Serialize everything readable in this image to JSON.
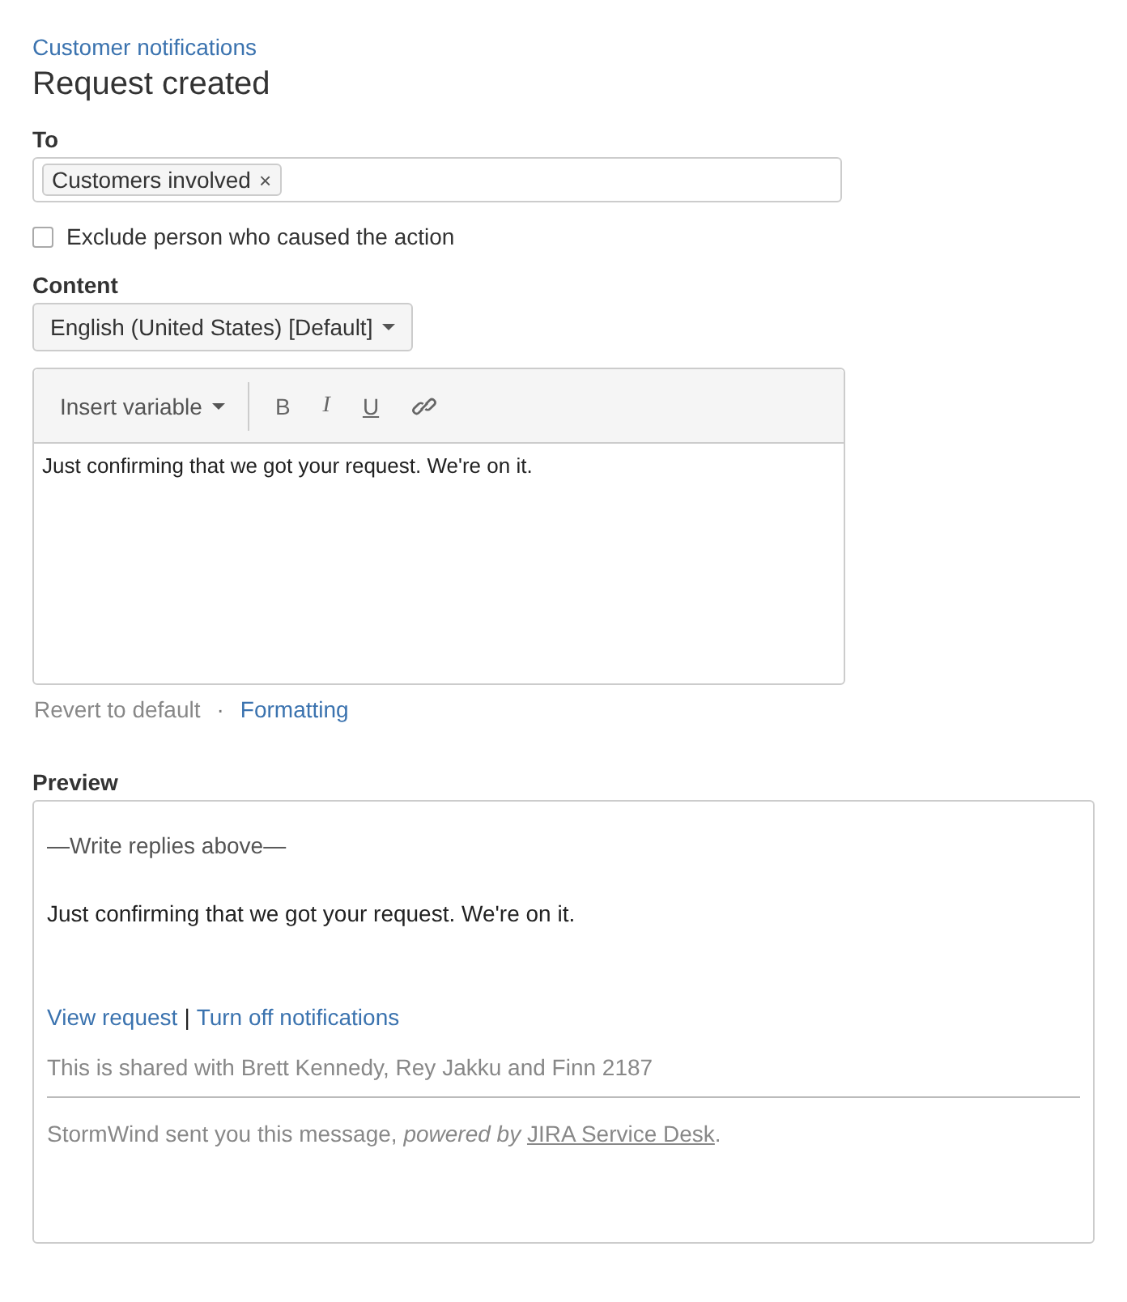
{
  "breadcrumb": "Customer notifications",
  "title": "Request created",
  "to": {
    "label": "To",
    "tags": [
      {
        "label": "Customers involved",
        "remove": "×"
      }
    ]
  },
  "exclude": {
    "label": "Exclude person who caused the action",
    "checked": false
  },
  "content": {
    "label": "Content",
    "language": "English (United States) [Default]"
  },
  "editor": {
    "insert_variable": "Insert variable",
    "format_buttons": [
      {
        "kind": "bold",
        "label": "B"
      },
      {
        "kind": "italic",
        "label": "I"
      },
      {
        "kind": "underline",
        "label": "U"
      },
      {
        "kind": "link"
      }
    ],
    "text": "Just confirming that we got your request. We're on it."
  },
  "actions": {
    "revert": "Revert to default",
    "separator": "·",
    "formatting": "Formatting"
  },
  "preview": {
    "label": "Preview",
    "reply_marker": "—Write replies above—",
    "body": "Just confirming that we got your request. We're on it.",
    "links": [
      {
        "label": "View request"
      },
      {
        "label": "Turn off notifications"
      }
    ],
    "link_separator": "|",
    "shared": "This is shared with Brett Kennedy, Rey Jakku and Finn 2187",
    "footer_prefix": "StormWind sent you this message, *powered by* ",
    "footer_link": "JIRA Service Desk",
    "footer_suffix": "."
  }
}
